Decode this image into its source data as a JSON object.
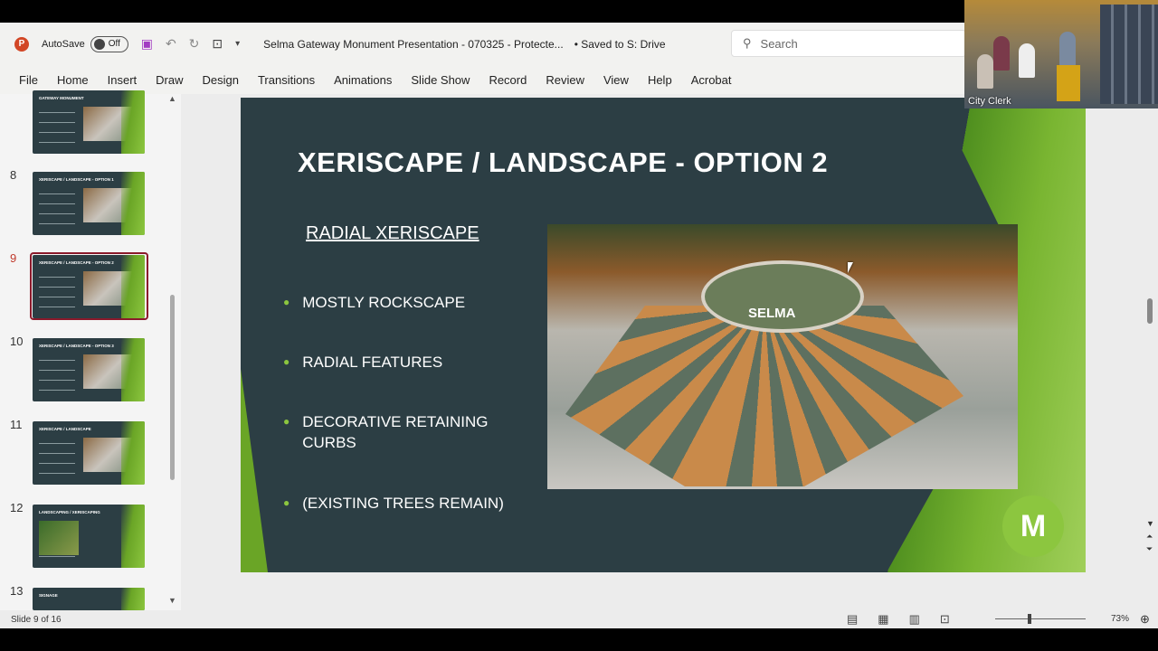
{
  "titlebar": {
    "app_icon": "P",
    "autosave_label": "AutoSave",
    "autosave_state": "Off",
    "doc_title": "Selma Gateway Monument Presentation - 070325  -  Protecte...",
    "save_status": "• Saved to S: Drive",
    "search_placeholder": "Search"
  },
  "menu": [
    "File",
    "Home",
    "Insert",
    "Draw",
    "Design",
    "Transitions",
    "Animations",
    "Slide Show",
    "Record",
    "Review",
    "View",
    "Help",
    "Acrobat"
  ],
  "thumbnails": [
    {
      "num": "",
      "title": "GATEWAY MONUMENT"
    },
    {
      "num": "8",
      "title": "XERISCAPE / LANDSCAPE - OPTION 1"
    },
    {
      "num": "9",
      "title": "XERISCAPE / LANDSCAPE - OPTION 2"
    },
    {
      "num": "10",
      "title": "XERISCAPE / LANDSCAPE - OPTION 3"
    },
    {
      "num": "11",
      "title": "XERISCAPE / LANDSCAPE"
    },
    {
      "num": "12",
      "title": "LANDSCAPING / XERISCAPING"
    },
    {
      "num": "13",
      "title": "SIGNAGE"
    }
  ],
  "slide": {
    "title": "XERISCAPE / LANDSCAPE - OPTION 2",
    "subtitle": "RADIAL XERISCAPE",
    "bullets": [
      "MOSTLY ROCKSCAPE",
      "RADIAL FEATURES",
      "DECORATIVE RETAINING CURBS",
      "(EXISTING TREES REMAIN)"
    ],
    "render_sign": "SELMA",
    "logo": "M"
  },
  "status": {
    "slide_info": "Slide 9 of 16",
    "zoom": "73%",
    "zoom_fraction": 0.36
  },
  "video": {
    "label": "City Clerk"
  },
  "colors": {
    "slide_bg": "#2c3e44",
    "accent_green": "#8cc63f",
    "selection": "#8b1a2b"
  }
}
